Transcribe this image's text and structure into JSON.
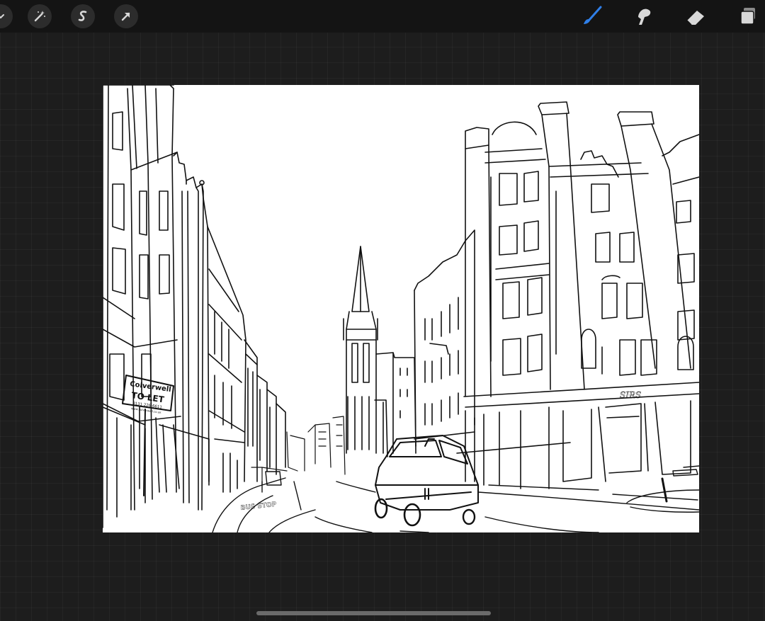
{
  "toolbar": {
    "left_tools": [
      {
        "name": "adjustments",
        "icon": "chevron-down-icon"
      },
      {
        "name": "adjustments",
        "icon": "magic-wand-icon"
      },
      {
        "name": "selection",
        "icon": "selection-s-icon"
      },
      {
        "name": "transform",
        "icon": "arrow-cursor-icon"
      }
    ],
    "right_tools": [
      {
        "name": "brush",
        "icon": "brush-icon",
        "active": true
      },
      {
        "name": "smudge",
        "icon": "smudge-icon"
      },
      {
        "name": "eraser",
        "icon": "eraser-icon"
      },
      {
        "name": "layers",
        "icon": "layers-icon"
      }
    ],
    "active_color": "#2f7fe8",
    "icon_color": "#d8d8d8"
  },
  "drawing": {
    "sign_line1": "Colverwell",
    "sign_line2": "TO LET",
    "sign_line3": "0131 226 6611",
    "sign_line4": "www.colverwell.co.uk",
    "road_marking": "BUS STOP",
    "shop_sign": "SIRS"
  }
}
